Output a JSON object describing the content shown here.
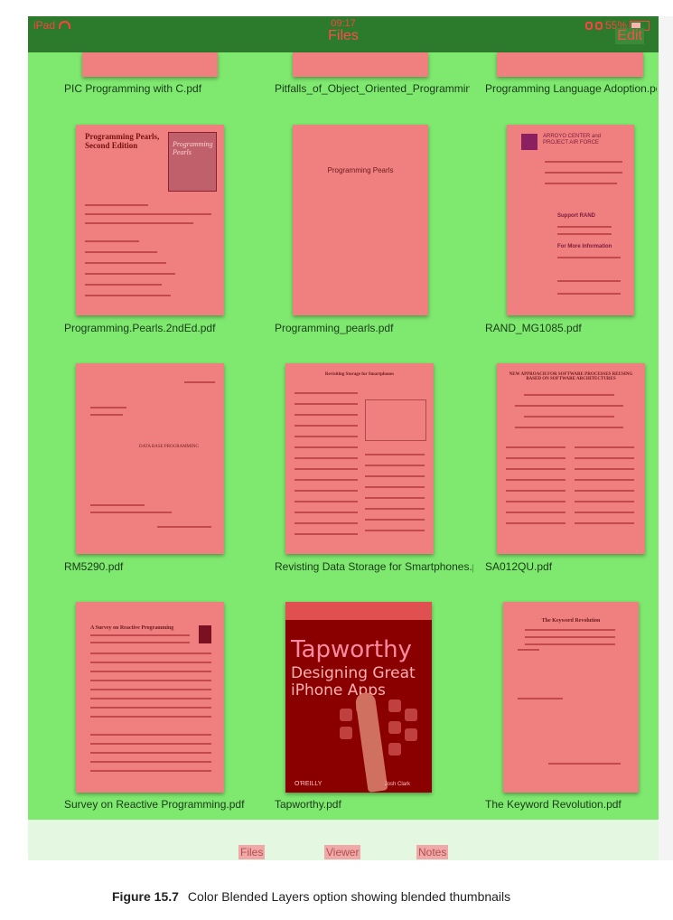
{
  "status_bar": {
    "device": "iPad",
    "time": "09:17",
    "battery": "55%",
    "battery_level": 0.55
  },
  "nav": {
    "title": "Files",
    "edit_label": "Edit"
  },
  "files": [
    "PIC Programming with C.pdf",
    "Pitfalls_of_Object_Oriented_Programming_G",
    "Programming Language Adoption.pdf",
    "Programming.Pearls.2ndEd.pdf",
    "Programming_pearls.pdf",
    "RAND_MG1085.pdf",
    "RM5290.pdf",
    "Revisting Data Storage for Smartphones.pdf",
    "SA012QU.pdf",
    "Survey on Reactive Programming.pdf",
    "Tapworthy.pdf",
    "The Keyword Revolution.pdf"
  ],
  "thumbs": {
    "pearls2": {
      "title": "Programming Pearls, Second Edition",
      "cover": "Programming Pearls"
    },
    "pearls": {
      "title": "Programming Pearls"
    },
    "rand": {
      "title": "ARROYO CENTER and PROJECT AIR FORCE",
      "support": "Support RAND",
      "info": "For More Information"
    },
    "rm5290": {
      "title": "DATA BASE PROGRAMMING"
    },
    "storage": {
      "title": "Revisiting Storage for Smartphones"
    },
    "sa": {
      "title": "NEW APPROACH FOR SOFTWARE PROCESSES REUSING BASED ON SOFTWARE ARCHITECTURES"
    },
    "reactive": {
      "title": "A Survey on Reactive Programming"
    },
    "keyword": {
      "title": "The Keyword Revolution"
    },
    "tapworthy": {
      "title": "Tapworthy",
      "subtitle_1": "Designing Great",
      "subtitle_2": "iPhone Apps",
      "publisher": "O'REILLY",
      "author": "Josh Clark"
    }
  },
  "tabs": {
    "files": "Files",
    "viewer": "Viewer",
    "notes": "Notes"
  },
  "caption": {
    "number": "Figure 15.7",
    "text": "Color Blended Layers option showing blended thumbnails"
  },
  "colors": {
    "blended_green": "#7ee86f",
    "blended_red": "#f08080",
    "nav_green": "#2c7b2c"
  }
}
